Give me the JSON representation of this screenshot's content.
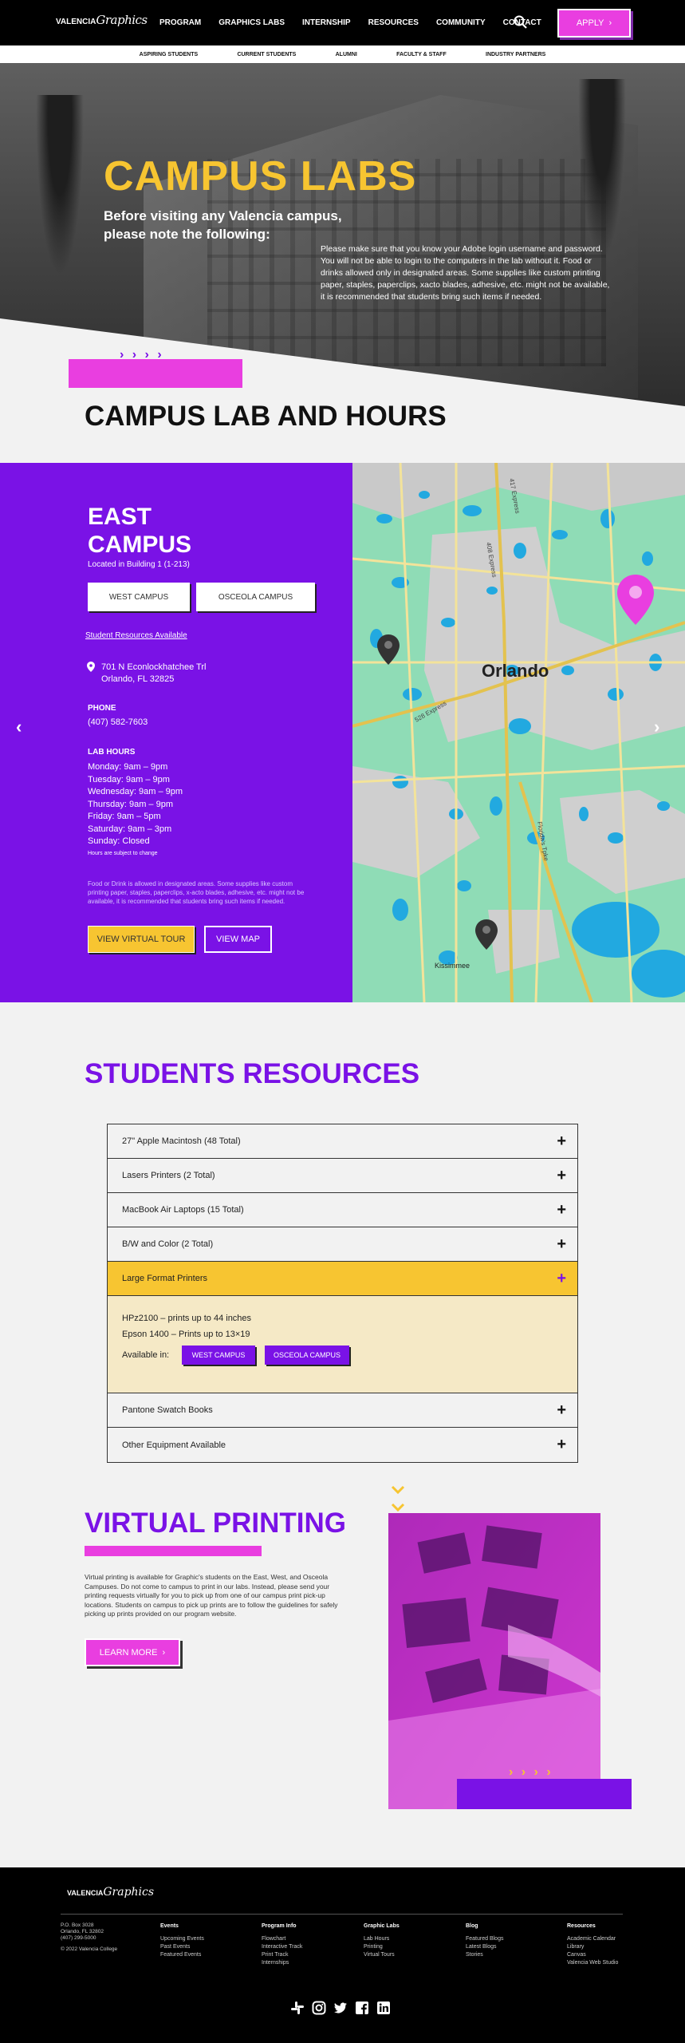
{
  "header": {
    "logo_text": "VALENCIA",
    "logo_script": "Graphics",
    "nav": [
      "PROGRAM",
      "GRAPHICS LABS",
      "INTERNSHIP",
      "RESOURCES",
      "COMMUNITY",
      "CONTACT"
    ],
    "apply_label": "APPLY",
    "sub_nav": [
      "ASPIRING STUDENTS",
      "CURRENT STUDENTS",
      "ALUMNI",
      "FACULTY & STAFF",
      "INDUSTRY PARTNERS"
    ]
  },
  "hero": {
    "title": "CAMPUS LABS",
    "subtitle": "Before visiting any Valencia campus, please note the following:",
    "body": "Please make sure that you know your Adobe login username and password. You will not be able to login to the computers in the lab without it. Food or drinks allowed only in designated areas. Some supplies like custom printing paper, staples, paperclips, xacto blades, adhesive, etc. might not be available, it is recommended that students bring such items if needed."
  },
  "lab_section": {
    "title": "CAMPUS LAB AND HOURS",
    "arrows": "› › › ›"
  },
  "campus": {
    "name": "EAST CAMPUS",
    "location": "Located in Building 1 (1-213)",
    "buttons": [
      "WEST CAMPUS",
      "OSCEOLA CAMPUS"
    ],
    "resources_link": "Student Resources Available",
    "address_line1": "701 N Econlockhatchee Trl",
    "address_line2": "Orlando, FL 32825",
    "phone_label": "PHONE",
    "phone": "(407) 582-7603",
    "hours_label": "LAB HOURS",
    "hours": [
      "Monday: 9am – 9pm",
      "Tuesday: 9am – 9pm",
      "Wednesday: 9am – 9pm",
      "Thursday: 9am – 9pm",
      "Friday: 9am – 5pm",
      "Saturday: 9am – 3pm",
      "Sunday: Closed"
    ],
    "hours_note": "Hours are subject to change",
    "note": "Food or Drink is allowed in designated areas. Some supplies like custom printing paper, staples, paperclips, x-acto blades, adhesive, etc. might not be available, it is recommended that students bring such items if needed.",
    "virtual_tour_label": "VIEW VIRTUAL TOUR",
    "view_map_label": "VIEW MAP"
  },
  "map": {
    "city": "Orlando",
    "town": "Kissimmee",
    "road1": "417 Express",
    "road2": "408 Express",
    "road3": "528 Express",
    "road4": "Florida's Tpke"
  },
  "resources": {
    "title": "STUDENTS RESOURCES",
    "items": [
      "27\" Apple Macintosh (48 Total)",
      "Lasers Printers (2 Total)",
      "MacBook Air Laptops (15 Total)",
      "B/W and Color (2 Total)",
      "Large Format Printers",
      "Pantone Swatch Books",
      "Other Equipment Available"
    ],
    "open_index": 4,
    "open_lines": [
      "HPz2100 – prints up to 44 inches",
      "Epson 1400 – Prints up to 13×19"
    ],
    "available_in": "Available in:",
    "available_buttons": [
      "WEST CAMPUS",
      "OSCEOLA CAMPUS"
    ]
  },
  "virtual_printing": {
    "title": "VIRTUAL PRINTING",
    "body": "Virtual printing is available for Graphic's students on the East, West, and Osceola Campuses. Do not come to campus to print in our labs. Instead, please send your printing requests virtually for you to pick up from one of our campus print pick-up locations. Students on campus to pick up prints are to follow the guidelines for safely picking up prints provided on our program website.",
    "button_label": "LEARN MORE",
    "arrows": "› › › ›"
  },
  "footer": {
    "logo_text": "VALENCIA",
    "logo_script": "Graphics",
    "address": [
      "P.O. Box 3028",
      "Orlando, FL 32802",
      "(407) 299-5000",
      "",
      "© 2022 Valencia College"
    ],
    "columns": [
      {
        "heading": "Events",
        "links": [
          "Upcoming Events",
          "Past Events",
          "Featured Events"
        ]
      },
      {
        "heading": "Program Info",
        "links": [
          "Flowchart",
          "Interactive Track",
          "Print Track",
          "Internships"
        ]
      },
      {
        "heading": "Graphic Labs",
        "links": [
          "Lab Hours",
          "Printing",
          "Virtual Tours"
        ]
      },
      {
        "heading": "Blog",
        "links": [
          "Featured Blogs",
          "Latest Blogs",
          "Stories"
        ]
      },
      {
        "heading": "Resources",
        "links": [
          "Academic Calendar",
          "Library",
          "Canvas",
          "Valencia Web Studio"
        ]
      }
    ],
    "social_icons": [
      "slack-icon",
      "instagram-icon",
      "twitter-icon",
      "facebook-icon",
      "linkedin-icon"
    ]
  },
  "colors": {
    "purple": "#7a12e6",
    "pink": "#e93ee0",
    "yellow": "#f7c531",
    "black": "#000000"
  }
}
